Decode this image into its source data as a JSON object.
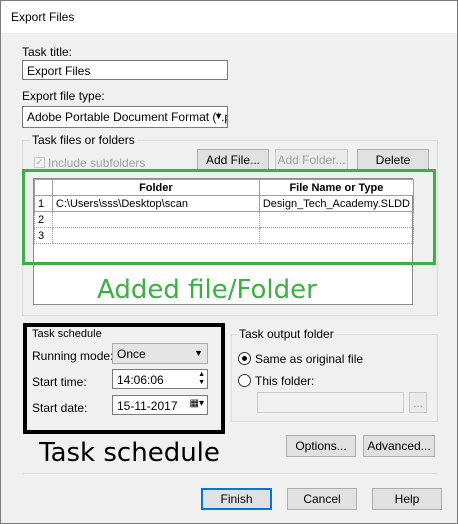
{
  "window": {
    "title": "Export Files"
  },
  "task_title": {
    "label": "Task title:",
    "value": "Export Files"
  },
  "export_type": {
    "label": "Export file type:",
    "value": "Adobe Portable Document Format  (*.p"
  },
  "files_group": {
    "label": "Task files or folders",
    "include_subfolders": "Include subfolders"
  },
  "buttons": {
    "add_file": "Add File...",
    "add_folder": "Add Folder...",
    "delete": "Delete",
    "options": "Options...",
    "advanced": "Advanced...",
    "finish": "Finish",
    "cancel": "Cancel",
    "help": "Help",
    "browse": "..."
  },
  "table": {
    "headers": [
      "Folder",
      "File Name or Type"
    ],
    "rows": [
      {
        "num": "1",
        "folder": "C:\\Users\\sss\\Desktop\\scan",
        "name": "Design_Tech_Academy.SLDD"
      },
      {
        "num": "2",
        "folder": "",
        "name": ""
      },
      {
        "num": "3",
        "folder": "",
        "name": ""
      }
    ]
  },
  "annotations": {
    "added": "Added file/Folder",
    "schedule": "Task schedule"
  },
  "schedule": {
    "label": "Task schedule",
    "running_mode_label": "Running mode:",
    "running_mode": "Once",
    "start_time_label": "Start time:",
    "start_time": "14:06:06",
    "start_date_label": "Start date:",
    "start_date": "15-11-2017"
  },
  "output": {
    "label": "Task output folder",
    "same": "Same as original file",
    "this_folder": "This folder:"
  },
  "colors": {
    "annotation_green": "#3cb043",
    "annotation_box": "#000000"
  }
}
